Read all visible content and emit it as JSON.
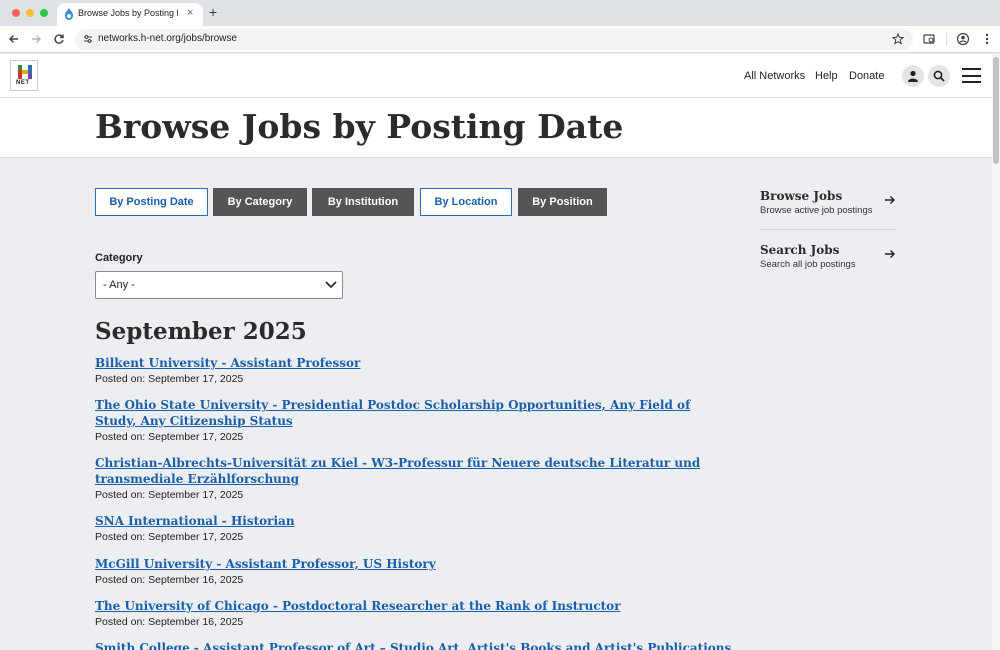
{
  "browser": {
    "tab_title": "Browse Jobs by Posting Date",
    "url": "networks.h-net.org/jobs/browse"
  },
  "header": {
    "logo_text": "NET",
    "nav": [
      "All Networks",
      "Help",
      "Donate"
    ]
  },
  "page": {
    "title": "Browse Jobs by Posting Date"
  },
  "tabs": [
    {
      "label": "By Posting Date",
      "style": "light"
    },
    {
      "label": "By Category",
      "style": "dark"
    },
    {
      "label": "By Institution",
      "style": "dark"
    },
    {
      "label": "By Location",
      "style": "light"
    },
    {
      "label": "By Position",
      "style": "dark"
    }
  ],
  "filter": {
    "label": "Category",
    "selected": "- Any -"
  },
  "listing": {
    "month": "September 2025",
    "date_prefix": "Posted on: ",
    "jobs": [
      {
        "title": "Bilkent University - Assistant Professor",
        "date": "Posted on: September 17, 2025"
      },
      {
        "title": "The Ohio State University - Presidential Postdoc Scholarship Opportunities, Any Field of Study, Any Citizenship Status",
        "date": "Posted on: September 17, 2025"
      },
      {
        "title": "Christian-Albrechts-Universität zu Kiel - W3-Professur für Neuere deutsche Literatur und transmediale Erzählforschung",
        "date": "Posted on: September 17, 2025"
      },
      {
        "title": "SNA International - Historian",
        "date": "Posted on: September 17, 2025"
      },
      {
        "title": "McGill University - Assistant Professor, US History",
        "date": "Posted on: September 16, 2025"
      },
      {
        "title": "The University of Chicago - Postdoctoral Researcher at the Rank of Instructor",
        "date": "Posted on: September 16, 2025"
      },
      {
        "title": "Smith College - Assistant Professor of Art – Studio Art, Artist's Books and Artist's Publications",
        "date": ""
      }
    ]
  },
  "sidebar": {
    "links": [
      {
        "title": "Browse Jobs",
        "desc": "Browse active job postings"
      },
      {
        "title": "Search Jobs",
        "desc": "Search all job postings"
      }
    ]
  },
  "colors": {
    "link": "#1a5fa8",
    "tab_dark": "#555555",
    "main_bg": "#eceef1"
  }
}
